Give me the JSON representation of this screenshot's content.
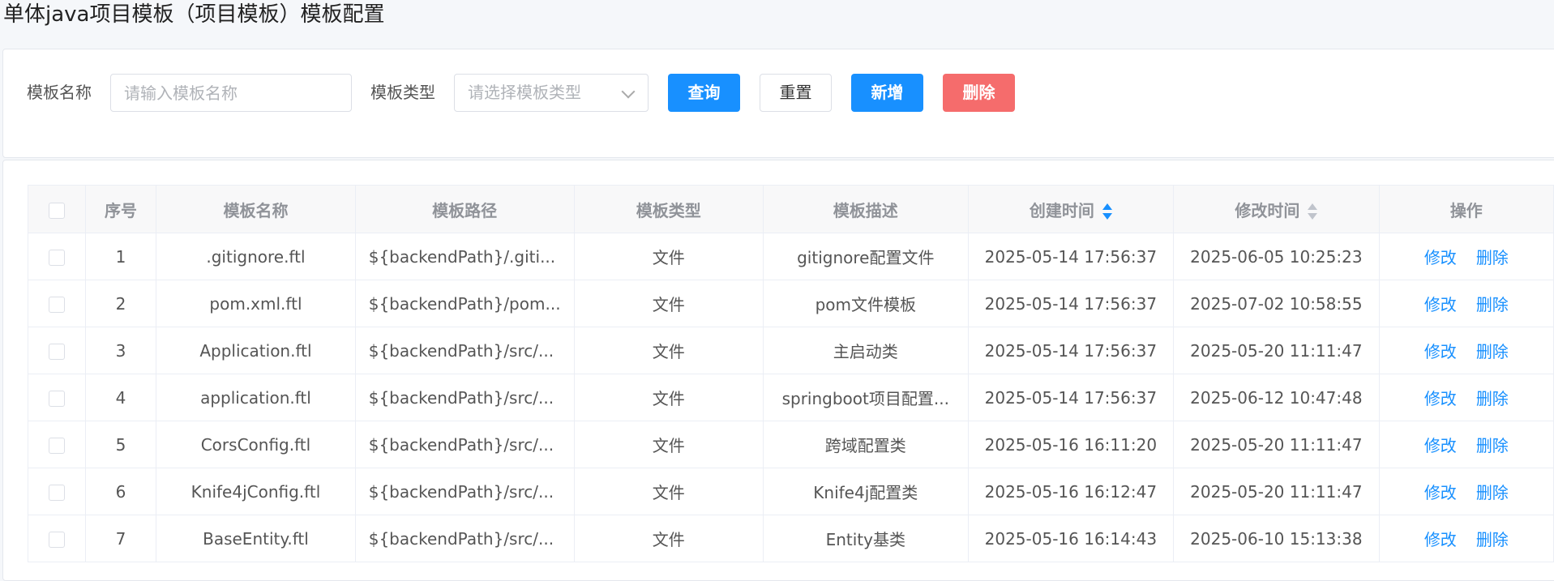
{
  "page": {
    "title": "单体java项目模板（项目模板）模板配置"
  },
  "search": {
    "name_label": "模板名称",
    "name_placeholder": "请输入模板名称",
    "type_label": "模板类型",
    "type_placeholder": "请选择模板类型",
    "query_label": "查询",
    "reset_label": "重置",
    "add_label": "新增",
    "delete_label": "删除"
  },
  "colors": {
    "primary": "#1890ff",
    "danger": "#f56c6c"
  },
  "table": {
    "headers": [
      "序号",
      "模板名称",
      "模板路径",
      "模板类型",
      "模板描述",
      "创建时间",
      "修改时间",
      "操作"
    ],
    "sort": {
      "created": "asc",
      "modified": "none"
    },
    "actions": {
      "edit": "修改",
      "delete": "删除"
    },
    "rows": [
      {
        "index": "1",
        "name": ".gitignore.ftl",
        "path": "${backendPath}/.giti...",
        "type": "文件",
        "desc": "gitignore配置文件",
        "created": "2025-05-14 17:56:37",
        "modified": "2025-06-05 10:25:23"
      },
      {
        "index": "2",
        "name": "pom.xml.ftl",
        "path": "${backendPath}/pom...",
        "type": "文件",
        "desc": "pom文件模板",
        "created": "2025-05-14 17:56:37",
        "modified": "2025-07-02 10:58:55"
      },
      {
        "index": "3",
        "name": "Application.ftl",
        "path": "${backendPath}/src/...",
        "type": "文件",
        "desc": "主启动类",
        "created": "2025-05-14 17:56:37",
        "modified": "2025-05-20 11:11:47"
      },
      {
        "index": "4",
        "name": "application.ftl",
        "path": "${backendPath}/src/...",
        "type": "文件",
        "desc": "springboot项目配置...",
        "created": "2025-05-14 17:56:37",
        "modified": "2025-06-12 10:47:48"
      },
      {
        "index": "5",
        "name": "CorsConfig.ftl",
        "path": "${backendPath}/src/...",
        "type": "文件",
        "desc": "跨域配置类",
        "created": "2025-05-16 16:11:20",
        "modified": "2025-05-20 11:11:47"
      },
      {
        "index": "6",
        "name": "Knife4jConfig.ftl",
        "path": "${backendPath}/src/...",
        "type": "文件",
        "desc": "Knife4j配置类",
        "created": "2025-05-16 16:12:47",
        "modified": "2025-05-20 11:11:47"
      },
      {
        "index": "7",
        "name": "BaseEntity.ftl",
        "path": "${backendPath}/src/...",
        "type": "文件",
        "desc": "Entity基类",
        "created": "2025-05-16 16:14:43",
        "modified": "2025-06-10 15:13:38"
      }
    ]
  }
}
